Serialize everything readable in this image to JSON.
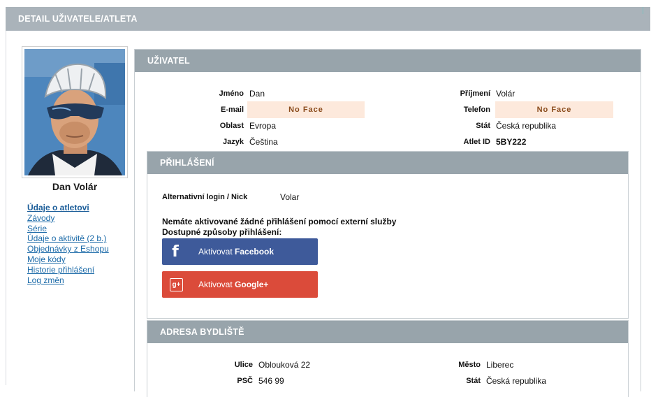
{
  "page": {
    "title": "DETAIL UŽIVATELE/ATLETA"
  },
  "profile": {
    "name": "Dan Volár"
  },
  "sidebar": {
    "items": [
      {
        "label": "Údaje o atletovi",
        "active": true
      },
      {
        "label": "Závody"
      },
      {
        "label": "Série"
      },
      {
        "label": "Údaje o aktivitě (2 b.)"
      },
      {
        "label": "Objednávky z Eshopu"
      },
      {
        "label": "Moje kódy"
      },
      {
        "label": "Historie přihlášení"
      },
      {
        "label": "Log změn"
      }
    ]
  },
  "user_section": {
    "header": "UŽIVATEL",
    "left": [
      {
        "label": "Jméno",
        "value": "Dan"
      },
      {
        "label": "E-mail",
        "value": "No Face"
      },
      {
        "label": "Oblast",
        "value": "Evropa"
      },
      {
        "label": "Jazyk",
        "value": "Čeština"
      }
    ],
    "right": [
      {
        "label": "Příjmení",
        "value": "Volár"
      },
      {
        "label": "Telefon",
        "value": "No Face"
      },
      {
        "label": "Stát",
        "value": "Česká republika"
      },
      {
        "label": "Atlet ID",
        "value": "5BY222"
      }
    ]
  },
  "login_section": {
    "header": "PŘIHLÁŠENÍ",
    "alt_login_label": "Alternativní login / Nick",
    "alt_login_value": "Volar",
    "no_external": "Nemáte aktivované žádné přihlášení pomocí externí služby",
    "available": "Dostupné způsoby přihlášení:",
    "facebook_prefix": "Aktivovat",
    "facebook_name": "Facebook",
    "google_prefix": "Aktivovat",
    "google_name": "Google+",
    "colors": {
      "facebook": "#3e5a9a",
      "google": "#db4b3a"
    }
  },
  "address_section": {
    "header": "ADRESA BYDLIŠTĚ",
    "left": [
      {
        "label": "Ulice",
        "value": "Oblouková 22"
      },
      {
        "label": "PSČ",
        "value": "546 99"
      }
    ],
    "right": [
      {
        "label": "Město",
        "value": "Liberec"
      },
      {
        "label": "Stát",
        "value": "Česká republika"
      }
    ]
  },
  "icons": {
    "facebook": "facebook-icon",
    "google": "google-plus-icon"
  }
}
